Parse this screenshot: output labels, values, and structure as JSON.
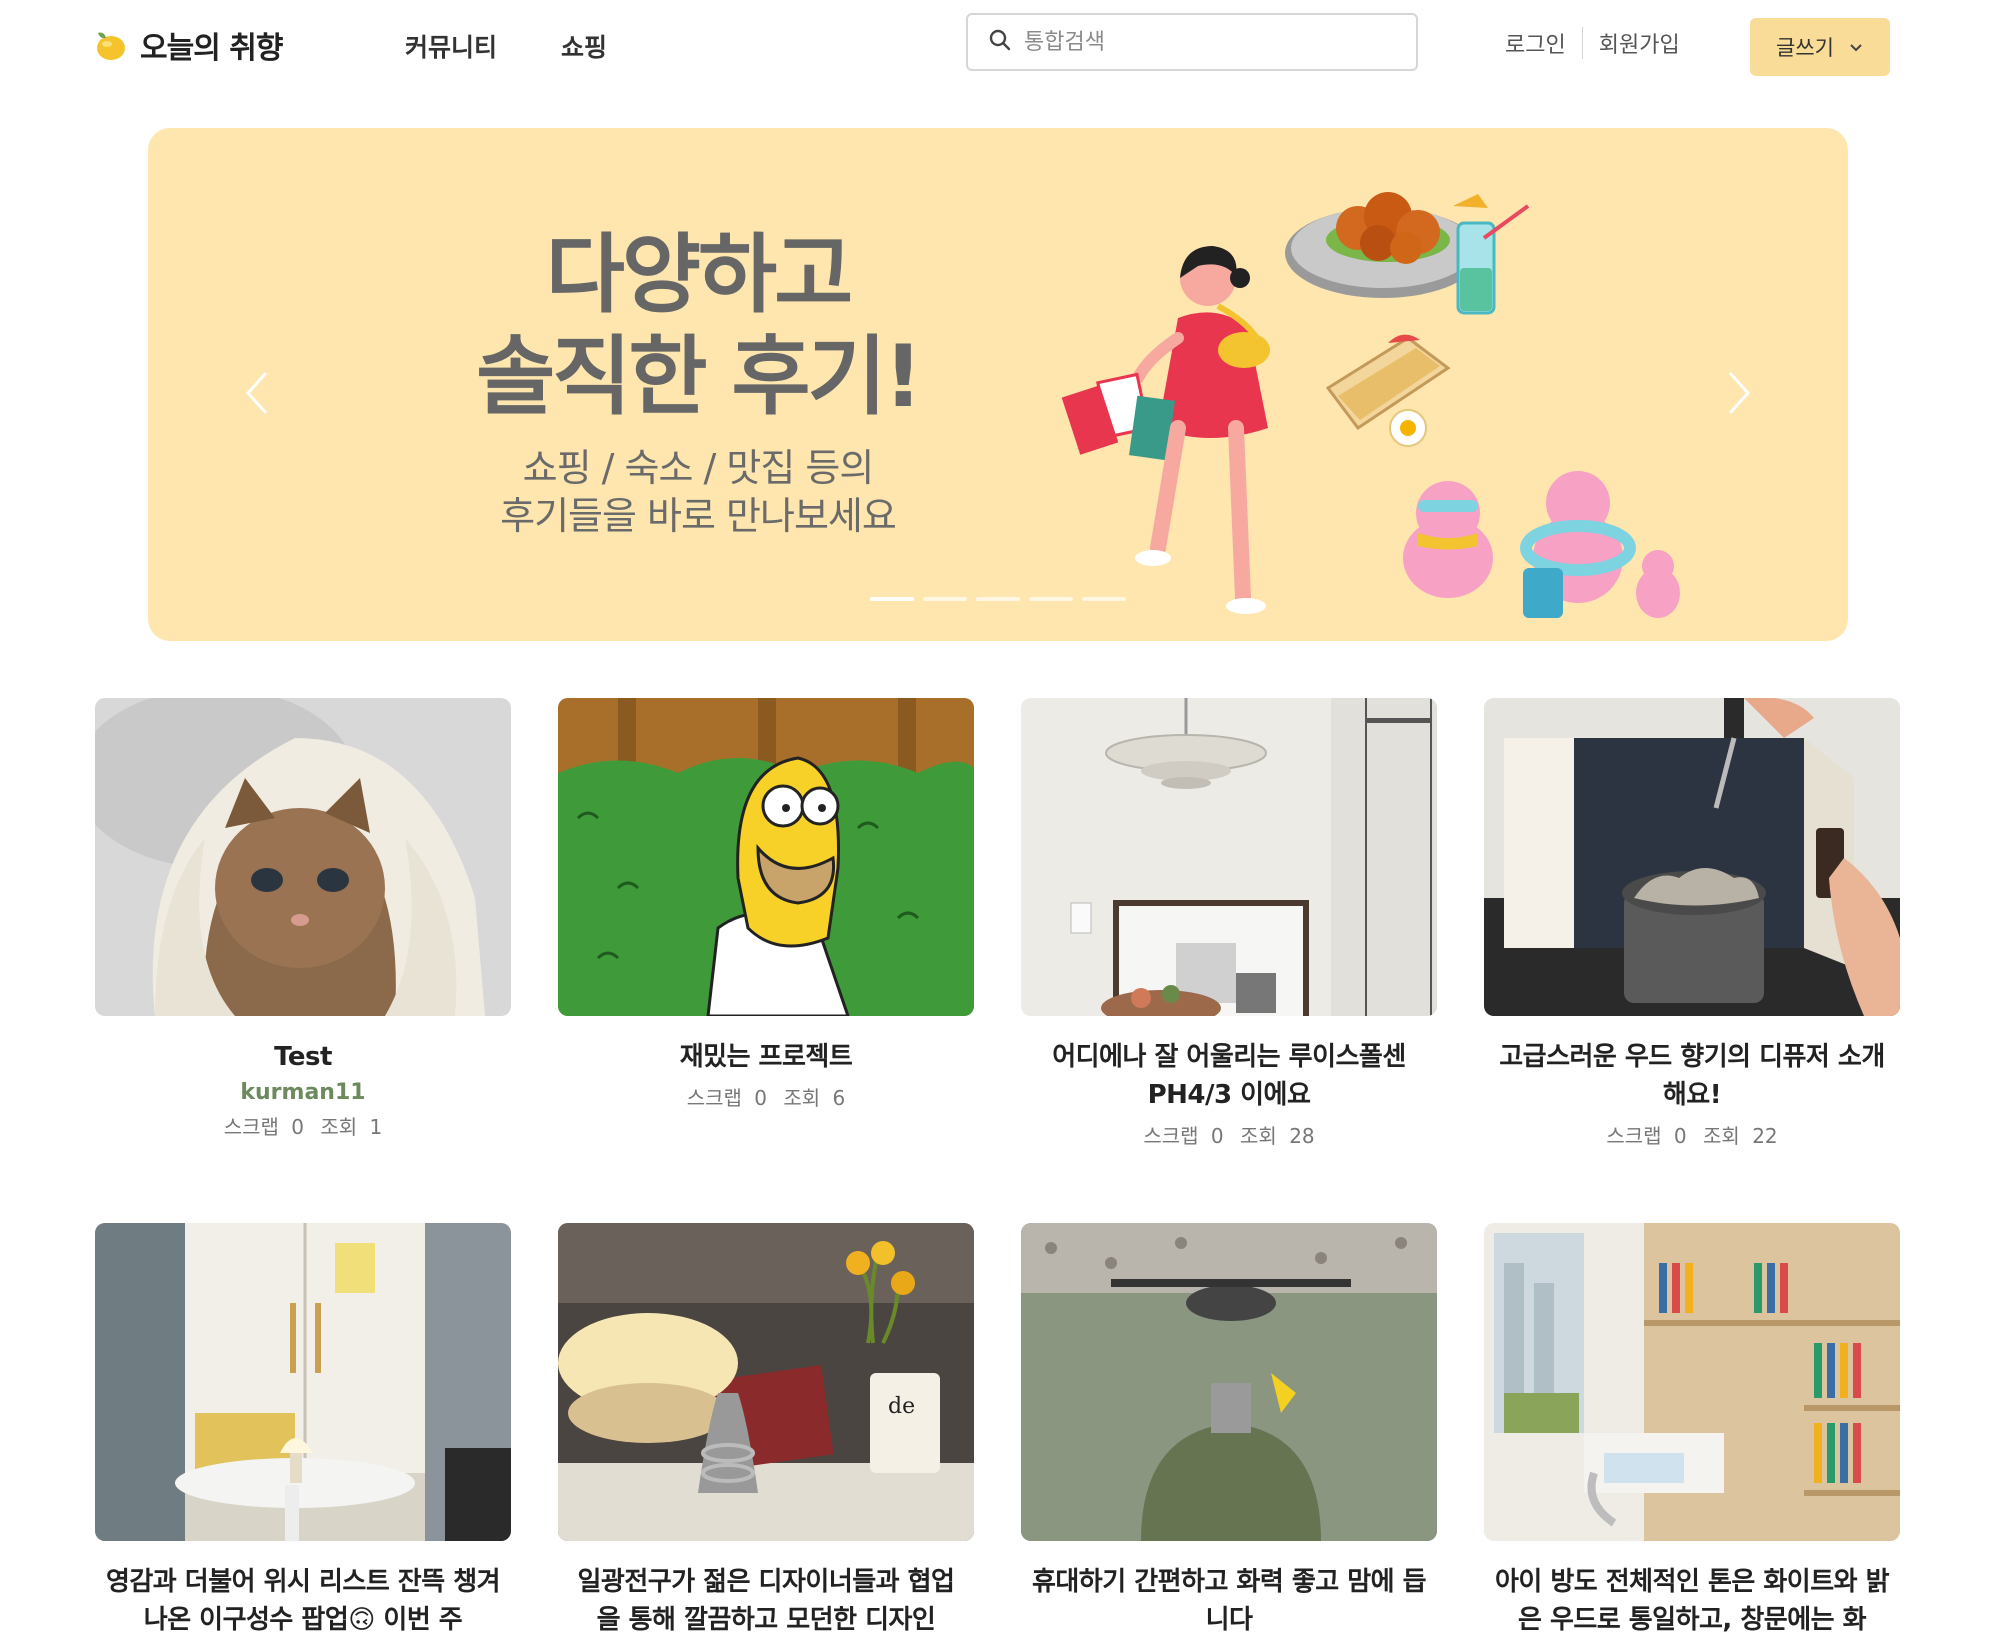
{
  "header": {
    "logo_text": "오늘의 취향",
    "logo_icon": "lemon-logo-icon",
    "nav": [
      "커뮤니티",
      "쇼핑"
    ],
    "search_placeholder": "통합검색",
    "login": "로그인",
    "signup": "회원가입",
    "write_button": "글쓰기"
  },
  "banner": {
    "title_line1": "다양하고",
    "title_line2": "솔직한 후기!",
    "subtitle_line1": "쇼핑 / 숙소 / 맛집 등의",
    "subtitle_line2": "후기들을 바로 만나보세요",
    "background_color": "#fee6ae",
    "slide_count": 5,
    "active_slide": 1
  },
  "cards": [
    {
      "title": "Test",
      "author": "kurman11",
      "scrap_label": "스크랩",
      "scrap": "0",
      "views_label": "조회",
      "views": "1",
      "image": "kitten-in-blanket"
    },
    {
      "title": "재밌는 프로젝트",
      "author": "",
      "scrap_label": "스크랩",
      "scrap": "0",
      "views_label": "조회",
      "views": "6",
      "image": "cartoon-man-in-hedge"
    },
    {
      "title": "어디에나 잘 어울리는 루이스폴센 PH4/3 이에요",
      "author": "",
      "scrap_label": "스크랩",
      "scrap": "0",
      "views_label": "조회",
      "views": "28",
      "image": "pendant-lamp-room"
    },
    {
      "title": "고급스러운 우드 향기의 디퓨저 소개해요!",
      "author": "",
      "scrap_label": "스크랩",
      "scrap": "0",
      "views_label": "조회",
      "views": "22",
      "image": "diffuser-box-dropper"
    },
    {
      "title": "영감과 더불어 위시 리스트 잔뜩 챙겨 나온 이구성수 팝업🙃 이번 주",
      "author": "",
      "image": "popup-store-lamp"
    },
    {
      "title": "일광전구가 젊은 디자이너들과 협업을 통해 깔끔하고 모던한 디자인",
      "author": "",
      "image": "mushroom-lamp-flowers"
    },
    {
      "title": "휴대하기 간편하고 화력 좋고 맘에 듭니다",
      "author": "",
      "image": "camping-gas-stove"
    },
    {
      "title": "아이 방도 전체적인 톤은 화이트와 밝은 우드로 통일하고, 창문에는 화",
      "author": "",
      "image": "kids-room-bookshelf"
    }
  ]
}
